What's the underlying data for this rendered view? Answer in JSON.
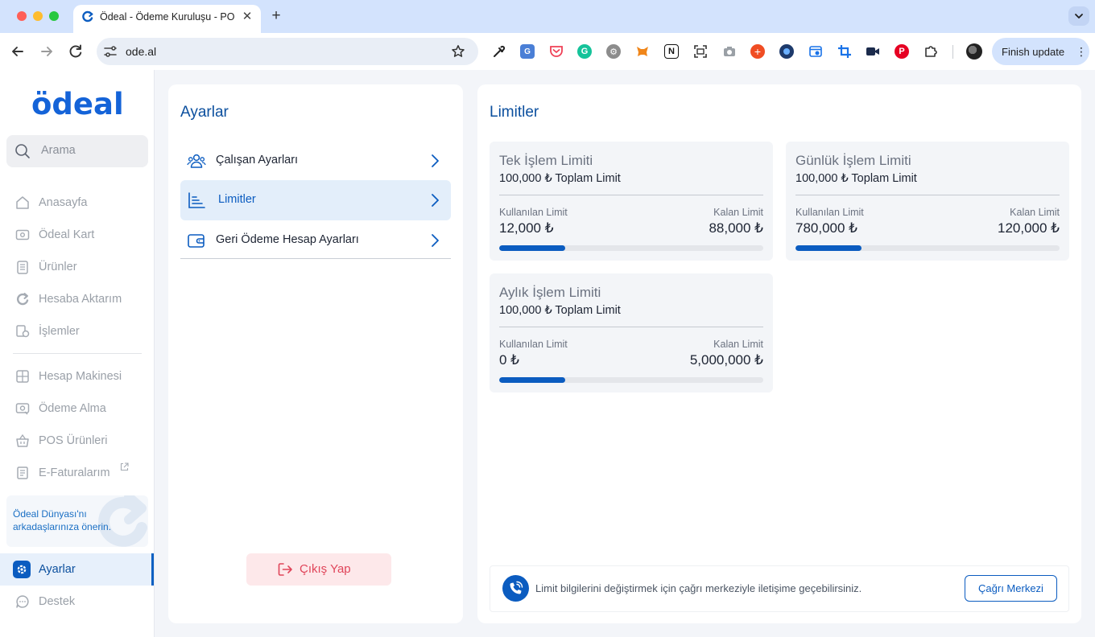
{
  "browser": {
    "tab_title": "Ödeal - Ödeme Kuruluşu - POS",
    "url": "ode.al",
    "finish_update_label": "Finish update"
  },
  "sidebar": {
    "logo_text": "ödeal",
    "search_placeholder": "Arama",
    "items": [
      {
        "label": "Anasayfa",
        "icon": "home-icon"
      },
      {
        "label": "Ödeal Kart",
        "icon": "card-icon"
      },
      {
        "label": "Ürünler",
        "icon": "products-icon"
      },
      {
        "label": "Hesaba Aktarım",
        "icon": "transfer-icon"
      },
      {
        "label": "İşlemler",
        "icon": "transactions-icon"
      },
      {
        "label": "Hesap Makinesi",
        "icon": "calculator-icon"
      },
      {
        "label": "Ödeme Alma",
        "icon": "payment-icon"
      },
      {
        "label": "POS Ürünleri",
        "icon": "basket-icon"
      },
      {
        "label": "E-Faturalarım",
        "icon": "invoice-icon"
      },
      {
        "label": "Ayarlar",
        "icon": "gear-icon"
      },
      {
        "label": "Destek",
        "icon": "chat-icon"
      }
    ],
    "promo_text": "Ödeal Dünyası'nı arkadaşlarınıza önerin."
  },
  "settings": {
    "title": "Ayarlar",
    "items": [
      {
        "label": "Çalışan Ayarları"
      },
      {
        "label": "Limitler"
      },
      {
        "label": "Geri Ödeme Hesap Ayarları"
      }
    ],
    "logout_label": "Çıkış Yap"
  },
  "limits": {
    "title": "Limitler",
    "cards": [
      {
        "title": "Tek İşlem Limiti",
        "total": "100,000 ₺ Toplam Limit",
        "used_label": "Kullanılan Limit",
        "used": "12,000 ₺",
        "remaining_label": "Kalan Limit",
        "remaining": "88,000 ₺",
        "progress": 0.25
      },
      {
        "title": "Günlük İşlem Limiti",
        "total": "100,000 ₺ Toplam Limit",
        "used_label": "Kullanılan Limit",
        "used": "780,000 ₺",
        "remaining_label": "Kalan Limit",
        "remaining": "120,000 ₺",
        "progress": 0.25
      },
      {
        "title": "Aylık İşlem Limiti",
        "total": "100,000 ₺ Toplam Limit",
        "used_label": "Kullanılan Limit",
        "used": "0 ₺",
        "remaining_label": "Kalan Limit",
        "remaining": "5,000,000 ₺",
        "progress": 0.25
      }
    ],
    "info_text": "Limit bilgilerini değiştirmek için çağrı merkeziyle iletişime geçebilirsiniz.",
    "info_button": "Çağrı Merkezi"
  },
  "colors": {
    "brand": "#0b5cc0",
    "danger": "#e0455a"
  }
}
